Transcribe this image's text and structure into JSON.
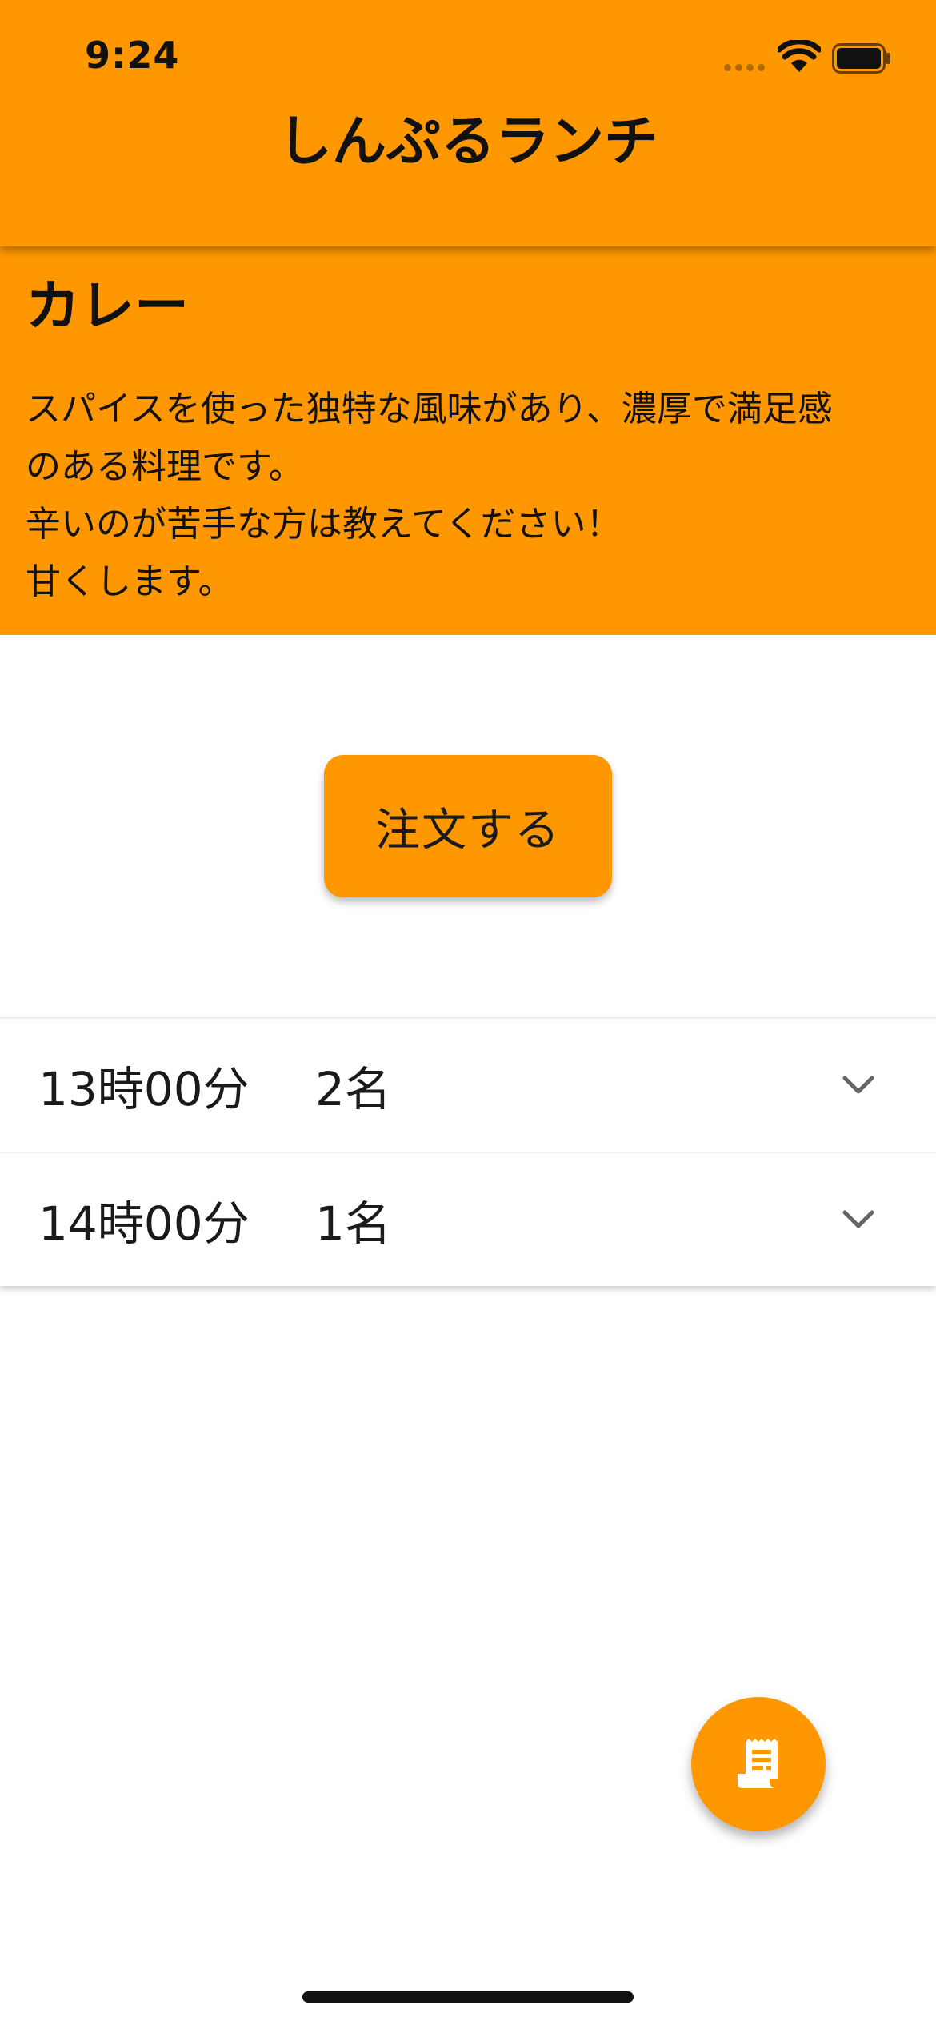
{
  "status_bar": {
    "time": "9:24"
  },
  "header": {
    "title": "しんぷるランチ",
    "background_color": "#ff9800"
  },
  "menu": {
    "name": "カレー",
    "description_lines": [
      "スパイスを使った独特な風味があり、濃厚で満足感",
      "のある料理です。",
      "辛いのが苦手な方は教えてください！",
      "甘くします。"
    ]
  },
  "order_button": {
    "label": "注文する"
  },
  "orders": [
    {
      "time": "13時00分",
      "count": "2名",
      "icon": "chevron-down-icon"
    },
    {
      "time": "14時00分",
      "count": "1名",
      "icon": "chevron-down-icon"
    }
  ],
  "fab": {
    "icon": "receipt-icon"
  },
  "colors": {
    "accent": "#ff9800",
    "text": "#1a1a1a",
    "background": "#ffffff"
  }
}
